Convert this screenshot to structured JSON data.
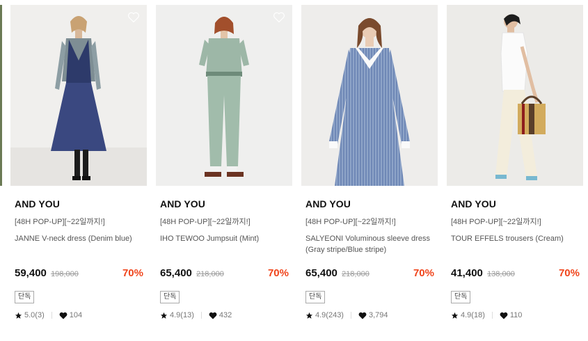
{
  "products": [
    {
      "brand": "AND YOU",
      "promo": "[48H POP-UP][~22일까지!]",
      "name": "JANNE V-neck dress (Denim blue)",
      "price": "59,400",
      "original_price": "198,000",
      "discount": "70%",
      "badge": "단독",
      "rating": "5.0(3)",
      "likes": "104"
    },
    {
      "brand": "AND YOU",
      "promo": "[48H POP-UP][~22일까지!]",
      "name": "IHO TEWOO Jumpsuit (Mint)",
      "price": "65,400",
      "original_price": "218,000",
      "discount": "70%",
      "badge": "단독",
      "rating": "4.9(13)",
      "likes": "432"
    },
    {
      "brand": "AND YOU",
      "promo": "[48H POP-UP][~22일까지!]",
      "name": "SALYEONI Voluminous sleeve dress (Gray stripe/Blue stripe)",
      "price": "65,400",
      "original_price": "218,000",
      "discount": "70%",
      "badge": "단독",
      "rating": "4.9(243)",
      "likes": "3,794"
    },
    {
      "brand": "AND YOU",
      "promo": "[48H POP-UP][~22일까지!]",
      "name": "TOUR EFFELS trousers (Cream)",
      "price": "41,400",
      "original_price": "138,000",
      "discount": "70%",
      "badge": "단독",
      "rating": "4.9(18)",
      "likes": "110"
    }
  ],
  "colors": {
    "discount": "#f0451c",
    "brand": "#111111",
    "muted": "#777777"
  },
  "icons": {
    "wishlist": "heart-outline-icon",
    "rating": "star-icon",
    "likes": "heart-filled-icon"
  }
}
